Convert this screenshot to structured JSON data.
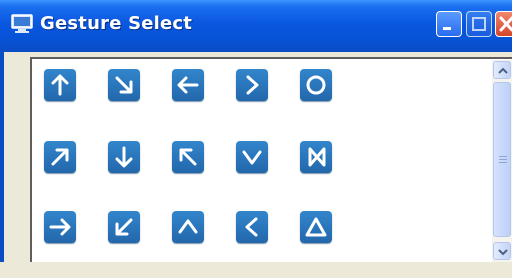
{
  "window": {
    "title": "Gesture Select",
    "title_bar_color": "#0a57e0"
  },
  "title_buttons": [
    "minimize-icon",
    "maximize-icon",
    "close-icon"
  ],
  "gesture_button_color": "#2367ab",
  "gestures": [
    {
      "name": "arrow-up",
      "glyph": "↑"
    },
    {
      "name": "arrow-down-right",
      "glyph": "↘"
    },
    {
      "name": "arrow-left",
      "glyph": "←"
    },
    {
      "name": "chevron-right",
      "glyph": ">"
    },
    {
      "name": "circle",
      "glyph": "O"
    },
    {
      "name": "arrow-up-right",
      "glyph": "↗"
    },
    {
      "name": "arrow-down",
      "glyph": "↓"
    },
    {
      "name": "arrow-up-left",
      "glyph": "↖"
    },
    {
      "name": "chevron-down",
      "glyph": "V"
    },
    {
      "name": "bowtie",
      "glyph": "⋈"
    },
    {
      "name": "arrow-right",
      "glyph": "→"
    },
    {
      "name": "arrow-down-left",
      "glyph": "↙"
    },
    {
      "name": "chevron-up",
      "glyph": "^"
    },
    {
      "name": "chevron-left",
      "glyph": "<"
    },
    {
      "name": "triangle",
      "glyph": "△"
    }
  ]
}
